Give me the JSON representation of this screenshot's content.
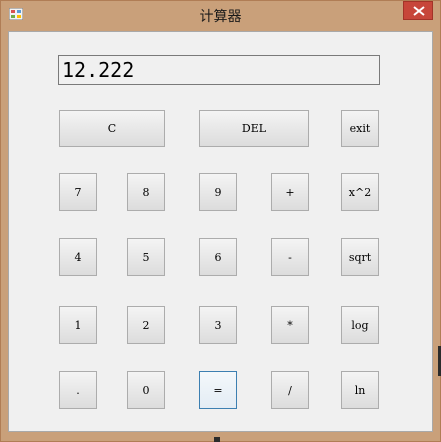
{
  "window": {
    "title": "计算器"
  },
  "display": {
    "value": "12.222"
  },
  "buttons": {
    "clear": "C",
    "delete": "DEL",
    "exit": "exit",
    "seven": "7",
    "eight": "8",
    "nine": "9",
    "plus": "+",
    "square": "x^2",
    "four": "4",
    "five": "5",
    "six": "6",
    "minus": "-",
    "sqrt": "sqrt",
    "one": "1",
    "two": "2",
    "three": "3",
    "multiply": "*",
    "log": "log",
    "dot": ".",
    "zero": "0",
    "equals": "=",
    "divide": "/",
    "ln": "ln"
  },
  "colors": {
    "frame": "#c9a07a",
    "close": "#c7463a",
    "client": "#f0f0f0",
    "focus": "#3c7fb1"
  }
}
